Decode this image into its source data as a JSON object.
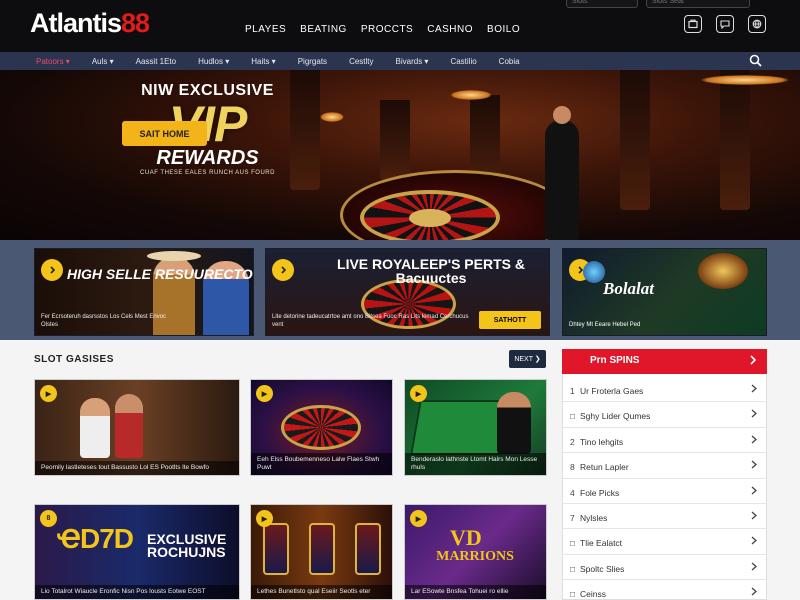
{
  "header": {
    "logo_text": "Atlantis",
    "logo_num": "88",
    "nav": [
      "PLAYES",
      "BEATING",
      "PROCCTS",
      "CASHNO",
      "BOILO"
    ],
    "search_placeholder_1": "Slots",
    "search_placeholder_2": "Slots Seat",
    "icons": [
      "wallet-icon",
      "chat-icon",
      "globe-icon"
    ]
  },
  "subnav": {
    "items": [
      "Patoors ▾",
      "Auls ▾",
      "Aassit 1Eto",
      "Hudlos ▾",
      "Haits ▾",
      "Pigrgats",
      "Cestlty",
      "Bivards ▾",
      "Castilio",
      "Cobia"
    ],
    "search_icon": "search-icon"
  },
  "hero": {
    "line1": "NIW EXCLUSIVE",
    "line2": "VIP",
    "line3": "REWARDS",
    "line4": "CUAF THESE EALES RUNCH AUS FOURD",
    "button": "SAIT HOME"
  },
  "promos": [
    {
      "title": "HIGH SELLE RESUURECTO",
      "caption": "Fer Ecrsoteruh dasrsstos Los Cels Mest Envoc Olstes"
    },
    {
      "title": "LIVE ROYALEEP'S PERTS & Bacuuctes",
      "caption": "Lite detorine tadeucatrtoe amt ono Bitsea Fuoc Ras Lits lemad Cerchucus vent",
      "button": "SATHOTT"
    },
    {
      "title": "Bolalat",
      "caption": "Dhtey Mt Eeare Hebel Ped"
    }
  ],
  "section": {
    "title": "SLOT GASISES",
    "button": "NEXT ❯"
  },
  "cards": [
    {
      "badge": "▶",
      "caption": "Peomily lastleteses tout Bassusto Lol ES Pootlts lte Bowfo"
    },
    {
      "badge": "▶",
      "caption": "Eeh Elss Boubemenneso Lalw Flaes Stwh Puwt"
    },
    {
      "badge": "▶",
      "caption": "Benderaslo lathnste Ltomt Halrs Mon Lesse rhuls"
    },
    {
      "badge": "8",
      "big": "ҼD7D",
      "excl": "EXCLUSIVE ROCHUJNS",
      "caption": "Lio Totalrot Wiaucle Eronfic Nisn Pos lousts Eotwe EOST"
    },
    {
      "badge": "▶",
      "caption": "Lethes Bunetlsto qual Eseiir Seotls eter"
    },
    {
      "badge": "▶",
      "vd": "VD",
      "marr": "MARRIONS",
      "caption": "Lar ESowte Bnsfea Tohuei ro ellie"
    }
  ],
  "sidebar": {
    "header": "Prn SPINS",
    "items": [
      {
        "num": "1",
        "label": "Ur Froterla Gaes"
      },
      {
        "num": "□",
        "label": "Sghy Lider Qumes"
      },
      {
        "num": "2",
        "label": "Tino lehgits"
      },
      {
        "num": "8",
        "label": "Retun Lapler"
      },
      {
        "num": "4",
        "label": "Fole Picks"
      },
      {
        "num": "7",
        "label": "Nylsles"
      },
      {
        "num": "□",
        "label": "Tlie Ealatct"
      },
      {
        "num": "□",
        "label": "Spoltc Slies"
      },
      {
        "num": "□",
        "label": "Ceinss"
      }
    ]
  },
  "colors": {
    "accent_red": "#e0162b",
    "accent_gold": "#f3c41a",
    "nav_bg": "#2b3550",
    "header_bg": "#0d0d0f"
  }
}
